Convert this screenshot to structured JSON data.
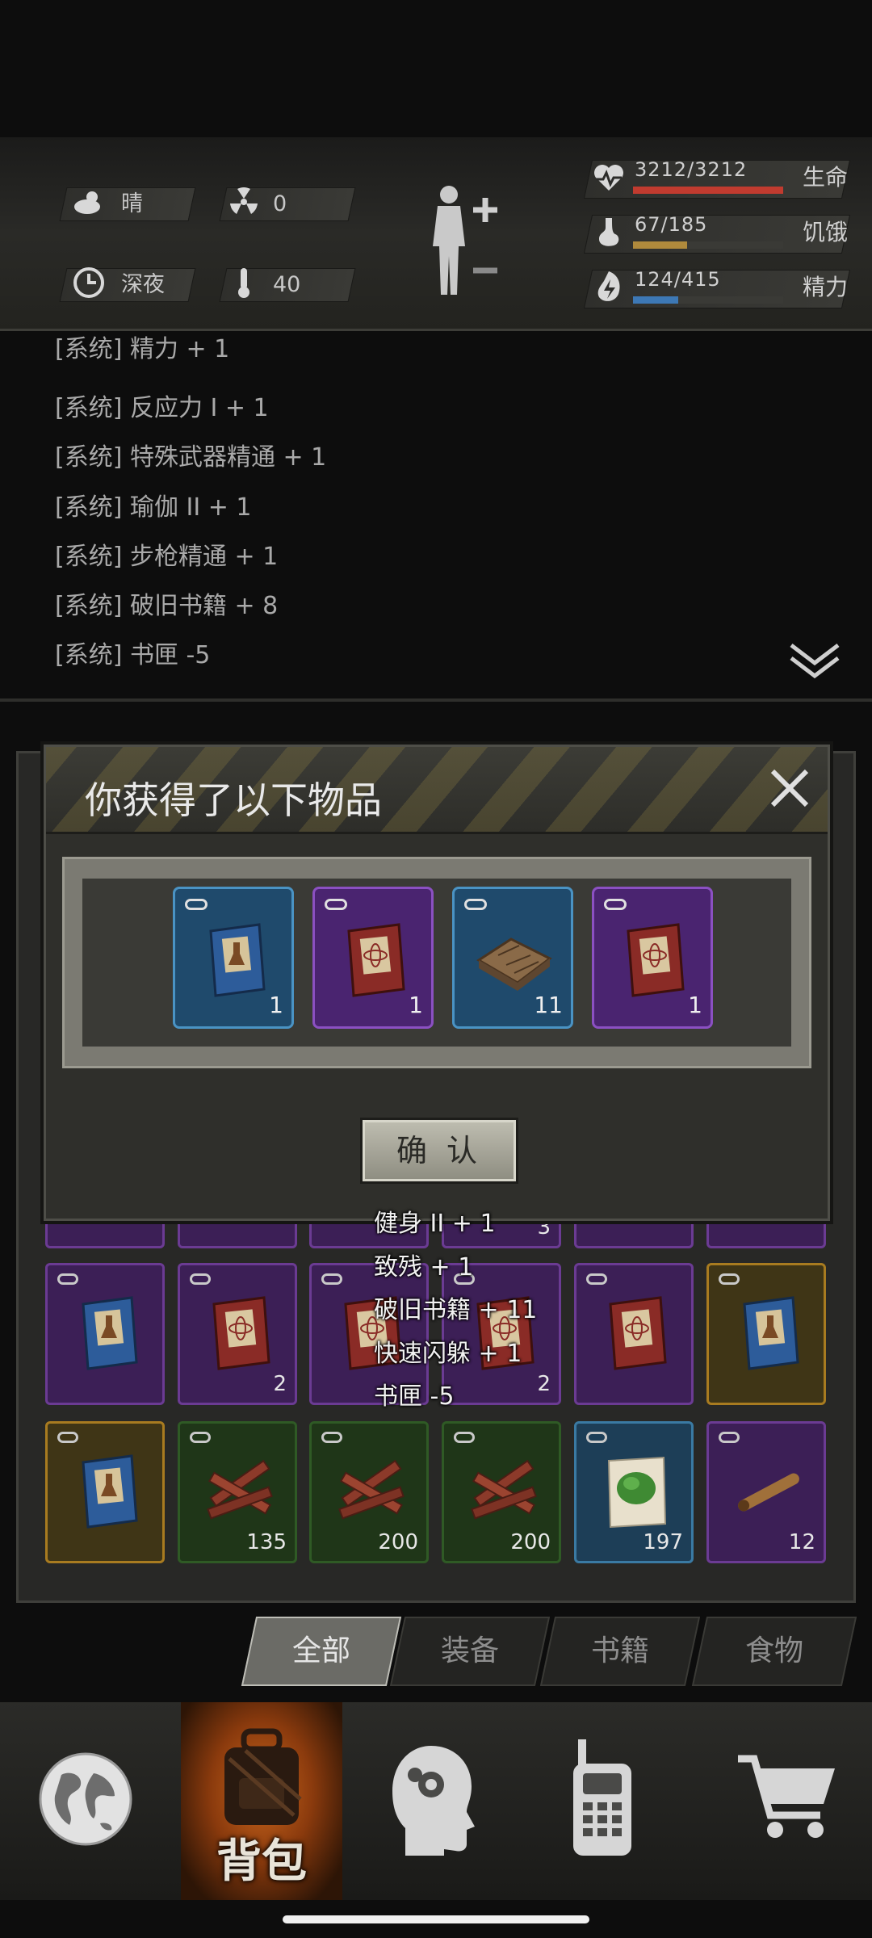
{
  "status": {
    "weather": "晴",
    "radiation": "0",
    "time_of_day": "深夜",
    "temperature": "40",
    "health": {
      "value": "3212/3212",
      "label": "生命",
      "fraction": 1.0,
      "color": "#c13b2f"
    },
    "hunger": {
      "value": "67/185",
      "label": "饥饿",
      "fraction": 0.362,
      "color": "#b08a3c"
    },
    "energy": {
      "value": "124/415",
      "label": "精力",
      "fraction": 0.299,
      "color": "#3d78b5"
    }
  },
  "log": {
    "lines": [
      "[系统] 精力 + 1",
      "[系统] 反应力 I  + 1",
      "[系统] 特殊武器精通 + 1",
      "[系统] 瑜伽 II  + 1",
      "[系统] 步枪精通 + 1",
      "[系统] 破旧书籍 + 8",
      "[系统] 书匣 -5"
    ]
  },
  "inventory": {
    "row1": [
      {
        "rarity": "purple",
        "icon": "science-book-icon",
        "count": ""
      },
      {
        "rarity": "purple",
        "icon": "atom-book-icon",
        "count": "2"
      },
      {
        "rarity": "purple",
        "icon": "atom-book-icon",
        "count": ""
      },
      {
        "rarity": "purple",
        "icon": "atom-book-icon",
        "count": "2"
      },
      {
        "rarity": "purple",
        "icon": "atom-book-icon",
        "count": ""
      },
      {
        "rarity": "gold",
        "icon": "science-book-icon",
        "count": ""
      }
    ],
    "row2": [
      {
        "rarity": "gold",
        "icon": "science-book-icon",
        "count": ""
      },
      {
        "rarity": "green",
        "icon": "firewood-icon",
        "count": "135"
      },
      {
        "rarity": "green",
        "icon": "firewood-icon",
        "count": "200"
      },
      {
        "rarity": "green",
        "icon": "firewood-icon",
        "count": "200"
      },
      {
        "rarity": "blue",
        "icon": "herb-paper-icon",
        "count": "197"
      },
      {
        "rarity": "purple",
        "icon": "cigar-icon",
        "count": "12"
      }
    ],
    "partial_count": "3"
  },
  "tabs": [
    "全部",
    "装备",
    "书籍",
    "食物"
  ],
  "nav": {
    "backpack_label": "背包"
  },
  "modal": {
    "title": "你获得了以下物品",
    "items": [
      {
        "rarity": "blue",
        "icon": "science-book-icon",
        "count": "1"
      },
      {
        "rarity": "purple",
        "icon": "atom-book-icon",
        "count": "1"
      },
      {
        "rarity": "blue",
        "icon": "old-books-icon",
        "count": "11"
      },
      {
        "rarity": "purple",
        "icon": "atom-book-icon",
        "count": "1"
      }
    ],
    "confirm_label": "确 认"
  },
  "toasts": [
    "健身 II  + 1",
    "致残 + 1",
    "破旧书籍 + 11",
    "快速闪躲 + 1",
    "书匣 -5"
  ]
}
